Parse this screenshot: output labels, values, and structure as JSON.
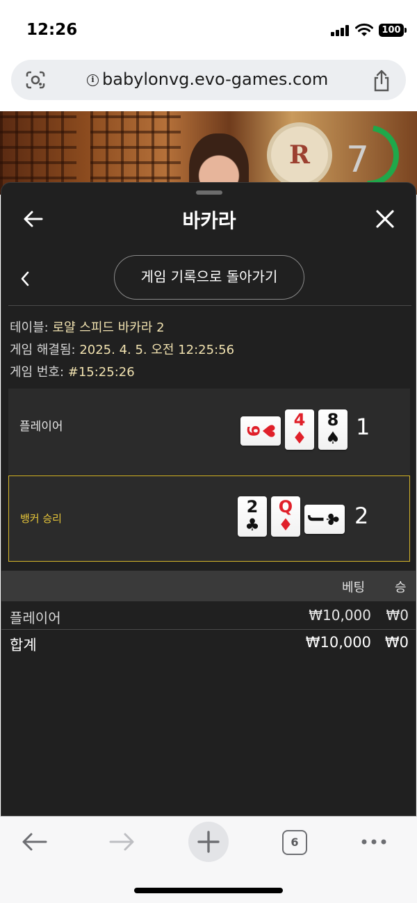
{
  "status_bar": {
    "time": "12:26",
    "battery": "100"
  },
  "browser": {
    "url": "babylonvg.evo-games.com",
    "tab_count": "6"
  },
  "video": {
    "emblem_letter": "R",
    "timer": "7"
  },
  "sheet": {
    "title": "바카라",
    "back_to_history_label": "게임 기록으로 돌아가기",
    "info": [
      {
        "label": "테이블: ",
        "value": "로얄 스피드 바카라 2"
      },
      {
        "label": "게임 해결됨: ",
        "value": "2025. 4. 5. 오전 12:25:56"
      },
      {
        "label": "게임 번호: ",
        "value": "#15:25:26"
      }
    ],
    "player": {
      "label": "플레이어",
      "score": "1",
      "cards": [
        {
          "rank": "9",
          "suit": "♥",
          "color": "#e0202a",
          "orientation": "horizontal"
        },
        {
          "rank": "4",
          "suit": "♦",
          "color": "#e0202a",
          "orientation": "vertical"
        },
        {
          "rank": "8",
          "suit": "♠",
          "color": "#111111",
          "orientation": "vertical"
        }
      ]
    },
    "banker": {
      "label": "뱅커 승리",
      "score": "2",
      "highlight_color": "#d8b82a",
      "cards": [
        {
          "rank": "2",
          "suit": "♣",
          "color": "#111111",
          "orientation": "vertical"
        },
        {
          "rank": "Q",
          "suit": "♦",
          "color": "#e0202a",
          "orientation": "vertical"
        },
        {
          "rank": "J",
          "suit": "♣",
          "color": "#111111",
          "orientation": "horizontal"
        }
      ]
    },
    "bets": {
      "header_bet": "베팅",
      "header_win": "승",
      "rows": [
        {
          "name": "플레이어",
          "amount": "₩10,000",
          "win": "₩0"
        }
      ],
      "total": {
        "name": "합계",
        "amount": "₩10,000",
        "win": "₩0"
      }
    }
  },
  "icons": [
    "google-lens-icon",
    "info-icon",
    "share-icon",
    "back-arrow-icon",
    "close-icon",
    "chevron-left-icon",
    "browser-back-icon",
    "browser-forward-icon",
    "new-tab-plus-icon",
    "tabs-icon",
    "more-icon"
  ]
}
